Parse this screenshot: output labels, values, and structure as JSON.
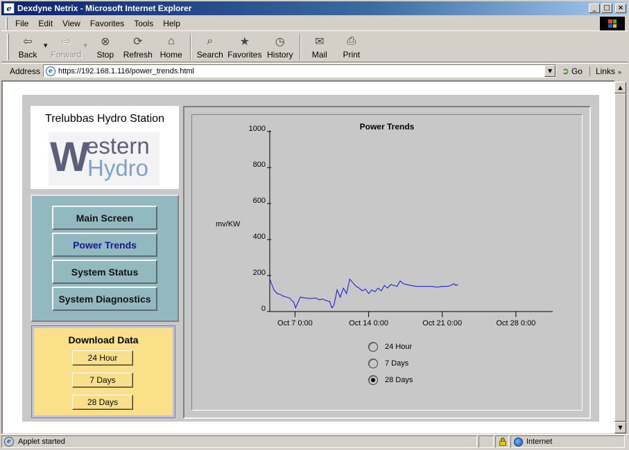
{
  "window": {
    "title": "Dexdyne Netrix - Microsoft Internet Explorer"
  },
  "menu": [
    "File",
    "Edit",
    "View",
    "Favorites",
    "Tools",
    "Help"
  ],
  "toolbar": {
    "back": "Back",
    "forward": "Forward",
    "stop": "Stop",
    "refresh": "Refresh",
    "home": "Home",
    "search": "Search",
    "favorites": "Favorites",
    "history": "History",
    "mail": "Mail",
    "print": "Print"
  },
  "address": {
    "label": "Address",
    "url": "https://192.168.1.116/power_trends.html",
    "go": "Go",
    "links": "Links"
  },
  "station": {
    "name": "Trelubbas Hydro Station",
    "logo_line1_w": "W",
    "logo_line1_rest": "estern",
    "logo_line2": "Hydro"
  },
  "nav": {
    "main_screen": "Main Screen",
    "power_trends": "Power Trends",
    "system_status": "System Status",
    "system_diagnostics": "System Diagnostics"
  },
  "download": {
    "title": "Download Data",
    "btn_24h": "24 Hour",
    "btn_7d": "7 Days",
    "btn_28d": "28 Days"
  },
  "chart_data": {
    "type": "line",
    "title": "Power Trends",
    "ylabel": "mv/KW",
    "xlabel": "",
    "ylim": [
      0,
      1000
    ],
    "yticks": [
      "0",
      "200",
      "400",
      "600",
      "800",
      "1000"
    ],
    "xticks": [
      "Oct 7 0:00",
      "Oct 14 0:00",
      "Oct 21 0:00",
      "Oct 28 0:00"
    ],
    "xlim_days": [
      4.6,
      31.5
    ],
    "series": [
      {
        "color": "#1010e0",
        "points": [
          [
            4.6,
            180
          ],
          [
            4.8,
            150
          ],
          [
            5.0,
            120
          ],
          [
            5.3,
            100
          ],
          [
            5.6,
            95
          ],
          [
            5.9,
            85
          ],
          [
            6.2,
            80
          ],
          [
            6.5,
            75
          ],
          [
            6.7,
            60
          ],
          [
            6.85,
            55
          ],
          [
            6.95,
            40
          ],
          [
            7.05,
            20
          ],
          [
            7.5,
            80
          ],
          [
            8.0,
            75
          ],
          [
            8.5,
            72
          ],
          [
            9.0,
            75
          ],
          [
            9.3,
            65
          ],
          [
            9.6,
            70
          ],
          [
            10.0,
            60
          ],
          [
            10.3,
            55
          ],
          [
            10.5,
            20
          ],
          [
            10.7,
            35
          ],
          [
            11.0,
            120
          ],
          [
            11.3,
            80
          ],
          [
            11.6,
            130
          ],
          [
            11.9,
            100
          ],
          [
            12.2,
            180
          ],
          [
            12.5,
            160
          ],
          [
            12.8,
            140
          ],
          [
            13.1,
            130
          ],
          [
            13.4,
            115
          ],
          [
            13.7,
            125
          ],
          [
            14.0,
            100
          ],
          [
            14.3,
            120
          ],
          [
            14.6,
            110
          ],
          [
            14.9,
            130
          ],
          [
            15.2,
            115
          ],
          [
            15.5,
            145
          ],
          [
            15.8,
            130
          ],
          [
            16.1,
            150
          ],
          [
            16.4,
            145
          ],
          [
            16.7,
            140
          ],
          [
            17.0,
            170
          ],
          [
            17.3,
            155
          ],
          [
            17.6,
            150
          ],
          [
            18.0,
            145
          ],
          [
            18.5,
            140
          ],
          [
            19.0,
            140
          ],
          [
            19.5,
            140
          ],
          [
            20.0,
            140
          ],
          [
            20.5,
            135
          ],
          [
            21.0,
            140
          ],
          [
            21.5,
            140
          ],
          [
            21.8,
            145
          ],
          [
            22.1,
            155
          ],
          [
            22.3,
            145
          ],
          [
            22.5,
            150
          ]
        ]
      }
    ],
    "grid": false,
    "legend": "none"
  },
  "chart_controls": {
    "opt_24h": "24 Hour",
    "opt_7d": "7 Days",
    "opt_28d": "28 Days",
    "selected": "28 Days"
  },
  "status": {
    "text": "Applet started",
    "zone": "Internet"
  }
}
